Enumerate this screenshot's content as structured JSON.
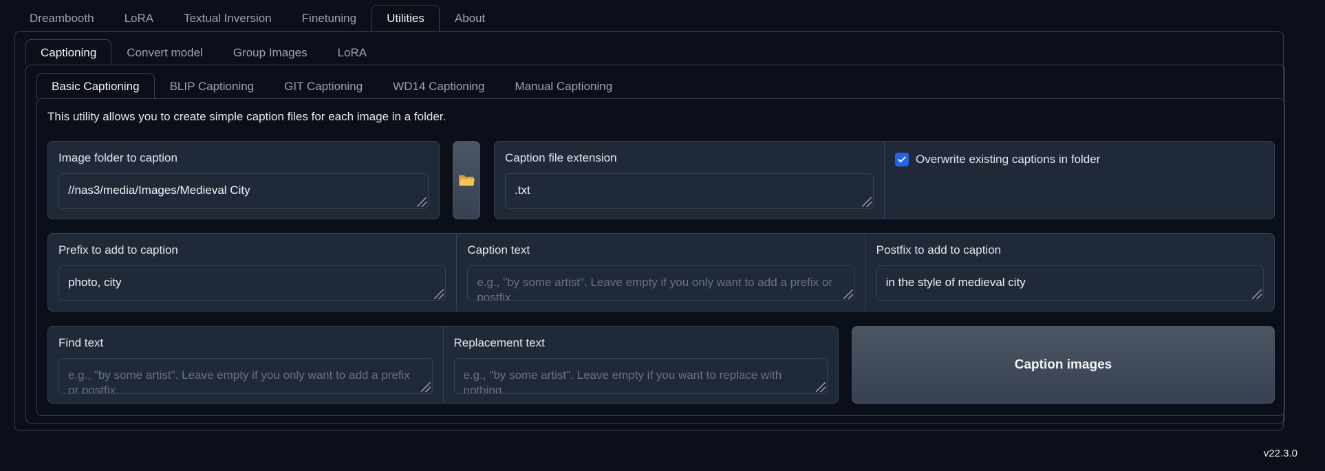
{
  "top_tabs": [
    "Dreambooth",
    "LoRA",
    "Textual Inversion",
    "Finetuning",
    "Utilities",
    "About"
  ],
  "top_tabs_selected": "Utilities",
  "utility_tabs": [
    "Captioning",
    "Convert model",
    "Group Images",
    "LoRA"
  ],
  "utility_tabs_selected": "Captioning",
  "caption_tabs": [
    "Basic Captioning",
    "BLIP Captioning",
    "GIT Captioning",
    "WD14 Captioning",
    "Manual Captioning"
  ],
  "caption_tabs_selected": "Basic Captioning",
  "description": "This utility allows you to create simple caption files for each image in a folder.",
  "image_folder": {
    "label": "Image folder to caption",
    "value": "//nas3/media/Images/Medieval City"
  },
  "folder_button": {
    "icon": "folder-icon"
  },
  "extension": {
    "label": "Caption file extension",
    "value": ".txt"
  },
  "overwrite": {
    "label": "Overwrite existing captions in folder",
    "checked": true
  },
  "prefix": {
    "label": "Prefix to add to caption",
    "value": "photo, city"
  },
  "caption_text": {
    "label": "Caption text",
    "placeholder": "e.g., \"by some artist\". Leave empty if you only want to add a prefix or postfix."
  },
  "postfix": {
    "label": "Postfix to add to caption",
    "value": "in the style of medieval city"
  },
  "find_text": {
    "label": "Find text",
    "placeholder": "e.g., \"by some artist\". Leave empty if you only want to add a prefix or postfix."
  },
  "replacement_text": {
    "label": "Replacement text",
    "placeholder": "e.g., \"by some artist\". Leave empty if you want to replace with nothing."
  },
  "caption_button": {
    "label": "Caption images"
  },
  "version": "v22.3.0",
  "colors": {
    "background": "#0b0f19",
    "panel": "#1f2937",
    "border": "#374151",
    "checkbox": "#2563eb",
    "button": "#4b5563"
  }
}
